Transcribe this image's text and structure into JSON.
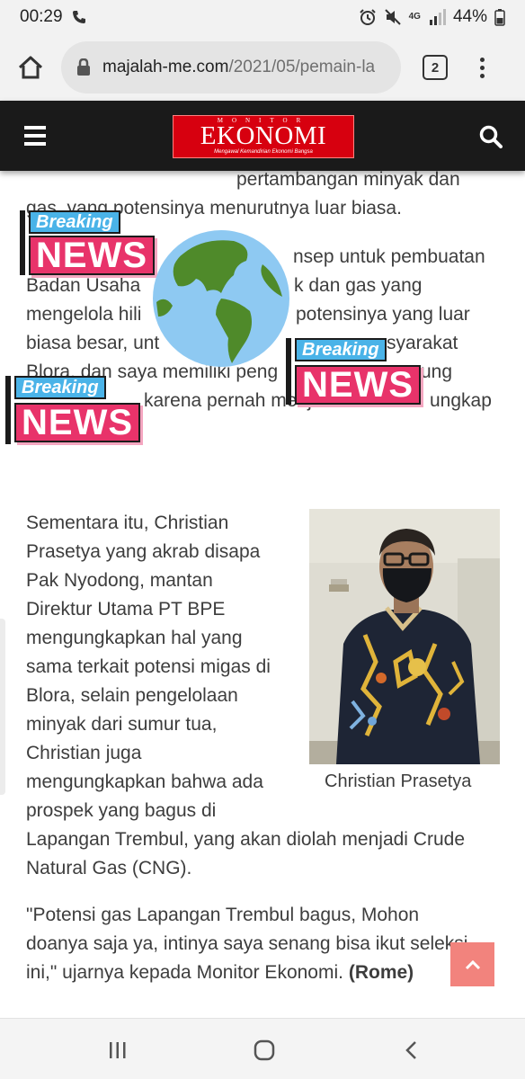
{
  "status_bar": {
    "time": "00:29",
    "network": "4G",
    "battery": "44%"
  },
  "browser": {
    "url_domain": "majalah-me.com",
    "url_path": "/2021/05/pemain-la",
    "tab_count": "2"
  },
  "site": {
    "logo_top": "MONITOR",
    "logo_main": "EKONOMI",
    "logo_tagline": "Mengawal Kemandirian Ekonomi Bangsa"
  },
  "article": {
    "lines_top": [
      "pertambangan minyak dan",
      "gas, yang potensinya menurutnya luar biasa."
    ],
    "lines_mid": [
      "nsep untuk pembuatan",
      "Badan Usaha",
      "k dan gas yang",
      "mengelola hili",
      "potensinya yang luar",
      "biasa besar, unt",
      "syarakat",
      "Blora, dan saya memiliki peng",
      "ung",
      "karena pernah menjadi",
      "ungkap"
    ],
    "para2": [
      "Sementara itu, Christian",
      "Prasetya yang akrab disapa",
      "Pak Nyodong, mantan",
      "Direktur Utama PT BPE",
      "mengungkapkan hal yang",
      "sama terkait potensi migas di",
      "Blora, selain pengelolaan",
      "minyak dari sumur tua,",
      "Christian juga",
      "mengungkapkan bahwa ada",
      "prospek yang bagus di",
      "Lapangan Trembul, yang akan diolah menjadi Crude",
      "Natural Gas (CNG)."
    ],
    "photo_caption": "Christian Prasetya",
    "quote_lines": [
      "\"Potensi gas Lapangan Trembul bagus, Mohon",
      "doanya saja ya, intinya saya senang bisa ikut seleksi",
      "ini,\"  ujarnya kepada Monitor Ekonomi."
    ],
    "author": "(Rome)"
  },
  "stickers": {
    "breaking": "Breaking",
    "news": "NEWS"
  }
}
